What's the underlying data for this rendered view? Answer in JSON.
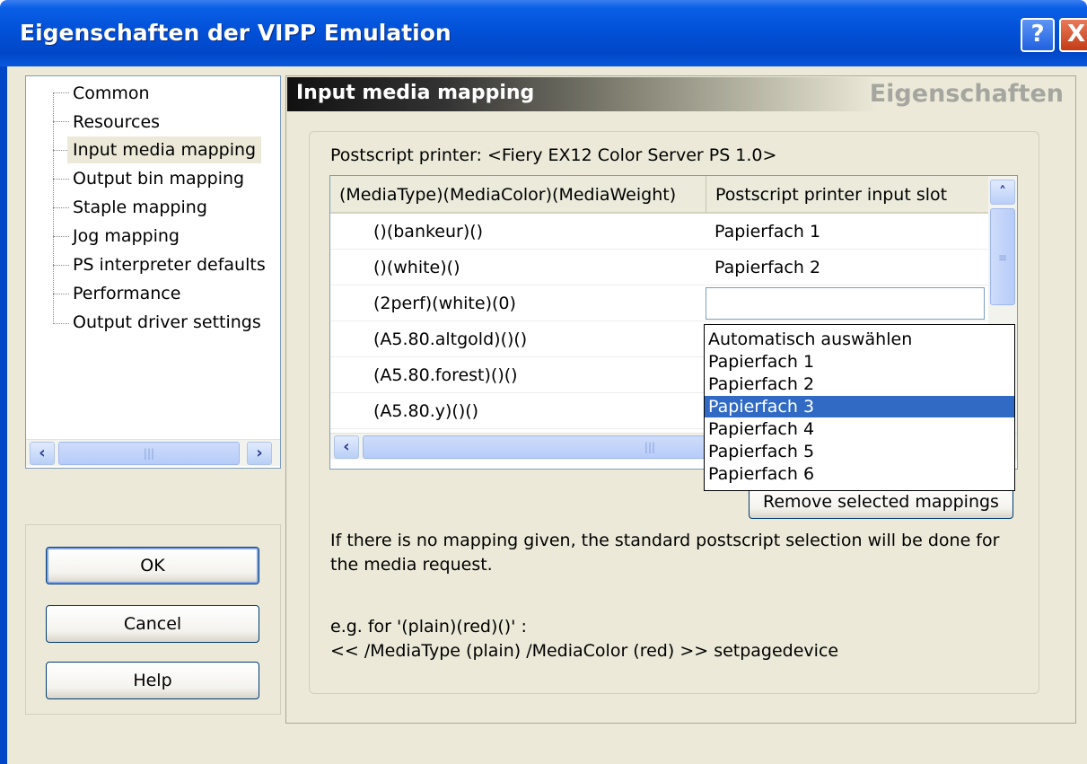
{
  "window": {
    "title": "Eigenschaften der VIPP Emulation",
    "help_glyph": "?",
    "close_glyph": "X",
    "titlebar_color": "#0251d8"
  },
  "tree": {
    "items": [
      {
        "label": "Common"
      },
      {
        "label": "Resources"
      },
      {
        "label": "Input media mapping",
        "selected": true
      },
      {
        "label": "Output bin mapping"
      },
      {
        "label": "Staple mapping"
      },
      {
        "label": "Jog mapping"
      },
      {
        "label": "PS interpreter defaults"
      },
      {
        "label": "Performance"
      },
      {
        "label": "Output driver settings"
      }
    ]
  },
  "buttons": {
    "ok": "OK",
    "cancel": "Cancel",
    "help": "Help"
  },
  "panel": {
    "title": "Input media mapping",
    "subtitle": "Eigenschaften",
    "printer_label": "Postscript printer: <Fiery EX12 Color Server PS 1.0>",
    "columns": [
      "(MediaType)(MediaColor)(MediaWeight)",
      "Postscript printer input slot"
    ],
    "rows": [
      {
        "media": "()(bankeur)()",
        "slot": "Papierfach 1"
      },
      {
        "media": "()(white)()",
        "slot": "Papierfach 2"
      },
      {
        "media": "(2perf)(white)(0)",
        "slot": ""
      },
      {
        "media": "(A5.80.altgold)()()",
        "slot": ""
      },
      {
        "media": "(A5.80.forest)()()",
        "slot": ""
      },
      {
        "media": "(A5.80.y)()()",
        "slot": ""
      }
    ],
    "dropdown_options": [
      "Automatisch auswählen",
      "Papierfach 1",
      "Papierfach 2",
      "Papierfach 3",
      "Papierfach 4",
      "Papierfach 5",
      "Papierfach 6"
    ],
    "dropdown_selected": "Papierfach 3",
    "remove_button": "Remove selected mappings",
    "info_line1": "If there is no mapping given, the standard postscript selection will be done for",
    "info_line2": "the media request.",
    "example_line1": "e.g. for '(plain)(red)()' :",
    "example_line2": "<< /MediaType (plain) /MediaColor (red) >> setpagedevice",
    "selection_color": "#316ac5"
  }
}
